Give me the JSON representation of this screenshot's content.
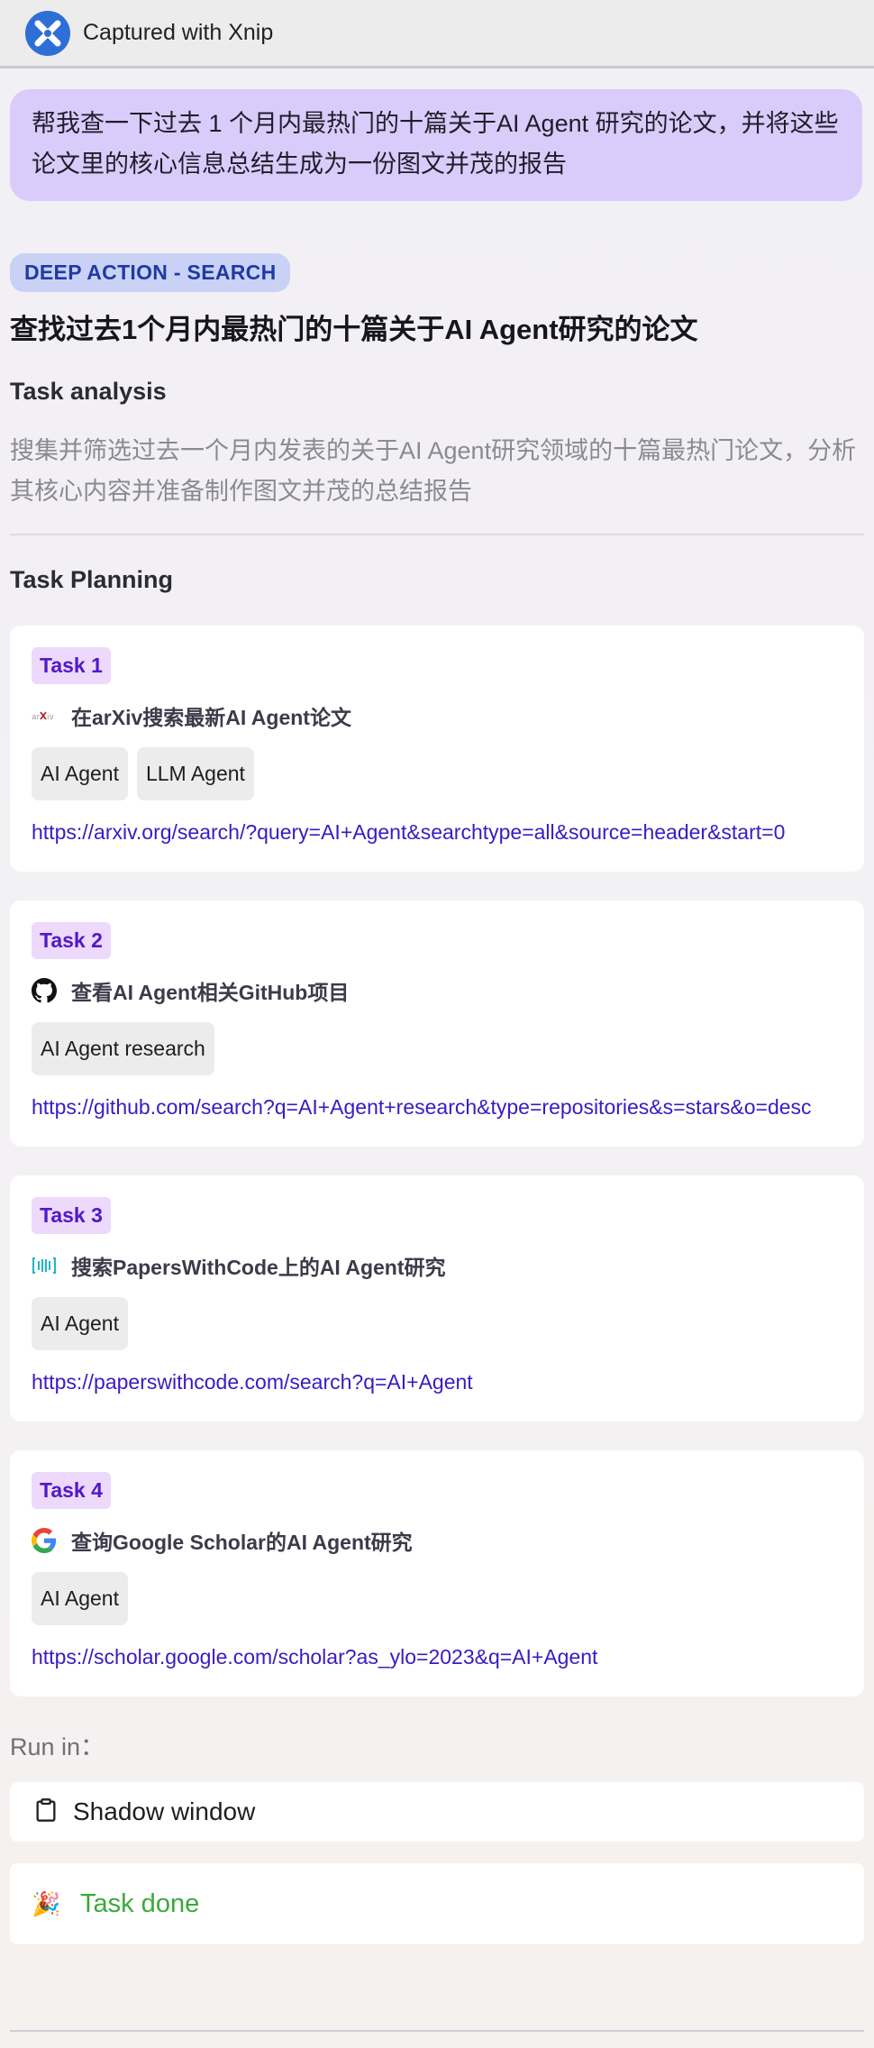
{
  "window": {
    "title": "Captured with Xnip"
  },
  "prompt": "帮我查一下过去 1 个月内最热门的十篇关于AI Agent 研究的论文，并将这些论文里的核心信息总结生成为一份图文并茂的报告",
  "action_badge": "DEEP ACTION - SEARCH",
  "main_title": "查找过去1个月内最热门的十篇关于AI Agent研究的论文",
  "analysis": {
    "heading": "Task analysis",
    "text": "搜集并筛选过去一个月内发表的关于AI Agent研究领域的十篇最热门论文，分析其核心内容并准备制作图文并茂的总结报告"
  },
  "planning": {
    "heading": "Task Planning",
    "tasks": [
      {
        "pill": "Task 1",
        "icon": "arxiv-icon",
        "label": "在arXiv搜索最新AI Agent论文",
        "chips": [
          "AI Agent",
          "LLM Agent"
        ],
        "link": "https://arxiv.org/search/?query=AI+Agent&searchtype=all&source=header&start=0"
      },
      {
        "pill": "Task 2",
        "icon": "github-icon",
        "label": "查看AI Agent相关GitHub项目",
        "chips": [
          "AI Agent research"
        ],
        "link": "https://github.com/search?q=AI+Agent+research&type=repositories&s=stars&o=desc"
      },
      {
        "pill": "Task 3",
        "icon": "paperswithcode-icon",
        "label": "搜索PapersWithCode上的AI Agent研究",
        "chips": [
          "AI Agent"
        ],
        "link": "https://paperswithcode.com/search?q=AI+Agent"
      },
      {
        "pill": "Task 4",
        "icon": "google-icon",
        "label": "查询Google Scholar的AI Agent研究",
        "chips": [
          "AI Agent"
        ],
        "link": "https://scholar.google.com/scholar?as_ylo=2023&q=AI+Agent"
      }
    ]
  },
  "run_in": {
    "label": "Run in：",
    "option": "Shadow window",
    "icon": "clipboard-icon"
  },
  "status": {
    "emoji": "🎉",
    "text": "Task done",
    "color": "#3aa93b"
  },
  "colors": {
    "prompt_bg": "#d9ccfb",
    "badge_bg": "#c9d2f4",
    "badge_text": "#1f3aa6",
    "task_pill_bg": "#ecd9fb",
    "task_pill_text": "#5118c8",
    "link": "#3b1ac4"
  }
}
